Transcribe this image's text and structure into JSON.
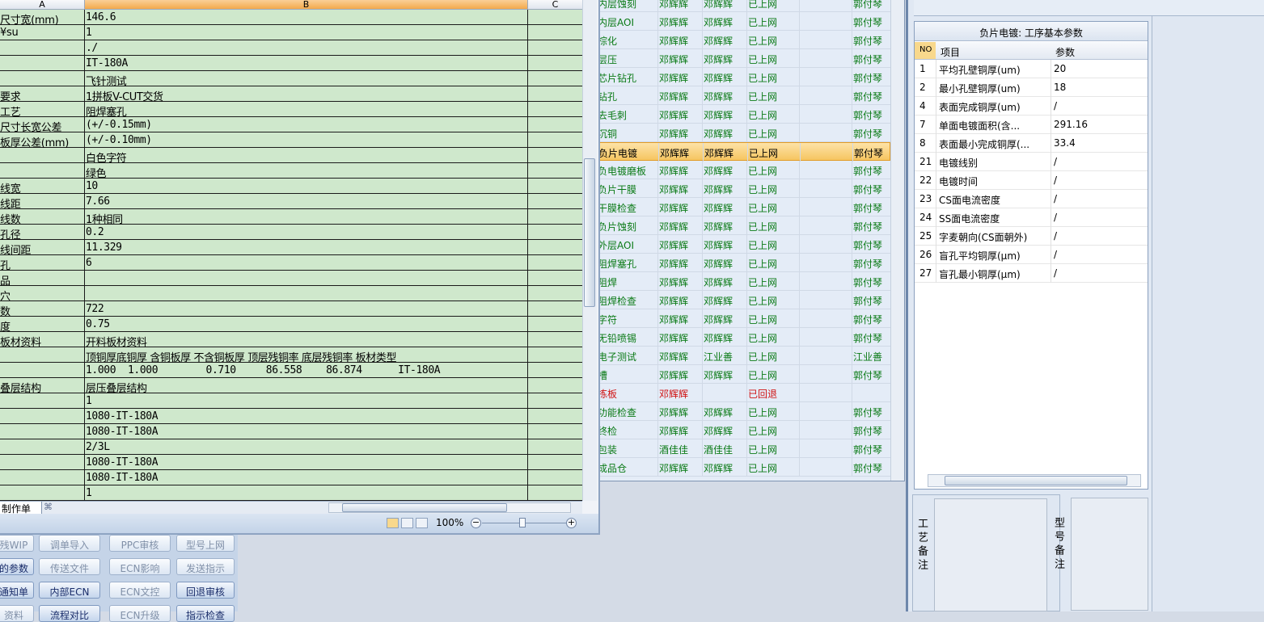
{
  "colors": {
    "grid_bg": "#cfe8cc",
    "proc_text": "#0a7a16",
    "returned_text": "#d01414",
    "selected_row": "#f6c561"
  },
  "excel": {
    "col_headers": [
      "A",
      "B",
      "C"
    ],
    "rows": [
      {
        "a": "尺寸宽(mm)",
        "b": "146.6"
      },
      {
        "a": "¥su",
        "b": "1"
      },
      {
        "a": "",
        "b": "./"
      },
      {
        "a": "",
        "b": "IT-180A"
      },
      {
        "a": "",
        "b": "飞针测试"
      },
      {
        "a": "要求",
        "b": "1拼板V-CUT交货"
      },
      {
        "a": "工艺",
        "b": "阻焊塞孔"
      },
      {
        "a": "尺寸长宽公差",
        "b": "(+/-0.15mm)"
      },
      {
        "a": "板厚公差(mm)",
        "b": "(+/-0.10mm)"
      },
      {
        "a": "",
        "b": "白色字符"
      },
      {
        "a": "",
        "b": "绿色"
      },
      {
        "a": "线宽",
        "b": "10"
      },
      {
        "a": "线距",
        "b": "7.66"
      },
      {
        "a": "线数",
        "b": "1种相同"
      },
      {
        "a": "孔径",
        "b": "0.2"
      },
      {
        "a": "线间距",
        "b": "11.329"
      },
      {
        "a": "孔",
        "b": "6"
      },
      {
        "a": "品",
        "b": ""
      },
      {
        "a": "穴",
        "b": ""
      },
      {
        "a": "数",
        "b": "722"
      },
      {
        "a": "度",
        "b": "0.75"
      },
      {
        "a": "板材资料",
        "b": "开料板材资料"
      },
      {
        "a": "",
        "b": "顶铜厚底铜厚 含铜板厚 不含铜板厚 顶层残铜率 底层残铜率 板材类型"
      },
      {
        "a": "",
        "b": "1.000  1.000        0.710     86.558    86.874      IT-180A"
      },
      {
        "a": "叠层结构",
        "b": "层压叠层结构"
      },
      {
        "a": "",
        "b": "1"
      },
      {
        "a": "",
        "b": "1080-IT-180A"
      },
      {
        "a": "",
        "b": "1080-IT-180A"
      },
      {
        "a": "",
        "b": "2/3L"
      },
      {
        "a": "",
        "b": "1080-IT-180A"
      },
      {
        "a": "",
        "b": "1080-IT-180A"
      },
      {
        "a": "",
        "b": "1"
      }
    ],
    "sheet_tab": "制作单",
    "zoom": "100%",
    "minus": "−",
    "plus": "+"
  },
  "buttons": [
    {
      "label": "残WIP",
      "active": false
    },
    {
      "label": "调单导入",
      "active": false
    },
    {
      "label": "PPC审核",
      "active": false
    },
    {
      "label": "型号上网",
      "active": false
    },
    {
      "label": "的参数",
      "active": true
    },
    {
      "label": "传送文件",
      "active": false
    },
    {
      "label": "ECN影响",
      "active": false
    },
    {
      "label": "发送指示",
      "active": false
    },
    {
      "label": "通知单",
      "active": true
    },
    {
      "label": "内部ECN",
      "active": true
    },
    {
      "label": "ECN文控",
      "active": false
    },
    {
      "label": "回退审核",
      "active": true
    },
    {
      "label": "资料",
      "active": false
    },
    {
      "label": "流程对比",
      "active": true
    },
    {
      "label": "ECN升级",
      "active": false
    },
    {
      "label": "指示检查",
      "active": true
    }
  ],
  "process": {
    "rows": [
      {
        "step": "内层蚀刻",
        "a": "邓辉辉",
        "b": "邓辉辉",
        "status": "已上网",
        "owner": "郭付琴"
      },
      {
        "step": "内层AOI",
        "a": "邓辉辉",
        "b": "邓辉辉",
        "status": "已上网",
        "owner": "郭付琴"
      },
      {
        "step": "棕化",
        "a": "邓辉辉",
        "b": "邓辉辉",
        "status": "已上网",
        "owner": "郭付琴"
      },
      {
        "step": "层压",
        "a": "邓辉辉",
        "b": "邓辉辉",
        "status": "已上网",
        "owner": "郭付琴"
      },
      {
        "step": "芯片钻孔",
        "a": "邓辉辉",
        "b": "邓辉辉",
        "status": "已上网",
        "owner": "郭付琴"
      },
      {
        "step": "钻孔",
        "a": "邓辉辉",
        "b": "邓辉辉",
        "status": "已上网",
        "owner": "郭付琴"
      },
      {
        "step": "去毛刺",
        "a": "邓辉辉",
        "b": "邓辉辉",
        "status": "已上网",
        "owner": "郭付琴"
      },
      {
        "step": "沉铜",
        "a": "邓辉辉",
        "b": "邓辉辉",
        "status": "已上网",
        "owner": "郭付琴"
      },
      {
        "step": "负片电镀",
        "a": "邓辉辉",
        "b": "邓辉辉",
        "status": "已上网",
        "owner": "郭付琴"
      },
      {
        "step": "负电镀磨板",
        "a": "邓辉辉",
        "b": "邓辉辉",
        "status": "已上网",
        "owner": "郭付琴"
      },
      {
        "step": "负片干膜",
        "a": "邓辉辉",
        "b": "邓辉辉",
        "status": "已上网",
        "owner": "郭付琴"
      },
      {
        "step": "干膜检查",
        "a": "邓辉辉",
        "b": "邓辉辉",
        "status": "已上网",
        "owner": "郭付琴"
      },
      {
        "step": "负片蚀刻",
        "a": "邓辉辉",
        "b": "邓辉辉",
        "status": "已上网",
        "owner": "郭付琴"
      },
      {
        "step": "外层AOI",
        "a": "邓辉辉",
        "b": "邓辉辉",
        "status": "已上网",
        "owner": "郭付琴"
      },
      {
        "step": "阻焊塞孔",
        "a": "邓辉辉",
        "b": "邓辉辉",
        "status": "已上网",
        "owner": "郭付琴"
      },
      {
        "step": "阻焊",
        "a": "邓辉辉",
        "b": "邓辉辉",
        "status": "已上网",
        "owner": "郭付琴"
      },
      {
        "step": "阻焊检查",
        "a": "邓辉辉",
        "b": "邓辉辉",
        "status": "已上网",
        "owner": "郭付琴"
      },
      {
        "step": "字符",
        "a": "邓辉辉",
        "b": "邓辉辉",
        "status": "已上网",
        "owner": "郭付琴"
      },
      {
        "step": "无铅喷锡",
        "a": "邓辉辉",
        "b": "邓辉辉",
        "status": "已上网",
        "owner": "郭付琴"
      },
      {
        "step": "电子测试",
        "a": "邓辉辉",
        "b": "江业善",
        "status": "已上网",
        "owner": "江业善"
      },
      {
        "step": "槽",
        "a": "邓辉辉",
        "b": "邓辉辉",
        "status": "已上网",
        "owner": "郭付琴"
      },
      {
        "step": "拣板",
        "a": "邓辉辉",
        "b": "",
        "status": "已回退",
        "owner": "",
        "returned": true
      },
      {
        "step": "功能检查",
        "a": "邓辉辉",
        "b": "邓辉辉",
        "status": "已上网",
        "owner": "郭付琴"
      },
      {
        "step": "终检",
        "a": "邓辉辉",
        "b": "邓辉辉",
        "status": "已上网",
        "owner": "郭付琴"
      },
      {
        "step": "包装",
        "a": "酒佳佳",
        "b": "酒佳佳",
        "status": "已上网",
        "owner": "郭付琴"
      },
      {
        "step": "成品仓",
        "a": "邓辉辉",
        "b": "邓辉辉",
        "status": "已上网",
        "owner": "郭付琴"
      }
    ],
    "selected_index": 8
  },
  "params": {
    "title": "负片电镀: 工序基本参数",
    "headers": {
      "no": "NO",
      "item": "项目",
      "value": "参数"
    },
    "rows": [
      {
        "no": "1",
        "item": "平均孔壁铜厚(um)",
        "value": "20"
      },
      {
        "no": "2",
        "item": "最小孔壁铜厚(um)",
        "value": "18"
      },
      {
        "no": "4",
        "item": "表面完成铜厚(um)",
        "value": "/"
      },
      {
        "no": "7",
        "item": "单面电镀面积(含...",
        "value": "291.16"
      },
      {
        "no": "8",
        "item": "表面最小完成铜厚(...",
        "value": "33.4"
      },
      {
        "no": "21",
        "item": "电镀线别",
        "value": "/"
      },
      {
        "no": "22",
        "item": "电镀时间",
        "value": "/"
      },
      {
        "no": "23",
        "item": "CS面电流密度",
        "value": "/"
      },
      {
        "no": "24",
        "item": "SS面电流密度",
        "value": "/"
      },
      {
        "no": "25",
        "item": "字麦朝向(CS面朝外)",
        "value": "/"
      },
      {
        "no": "26",
        "item": "盲孔平均铜厚(μm)",
        "value": "/"
      },
      {
        "no": "27",
        "item": "盲孔最小铜厚(μm)",
        "value": "/"
      }
    ]
  },
  "memo": {
    "craft_label": "工艺备注",
    "model_label": "型号备注"
  }
}
